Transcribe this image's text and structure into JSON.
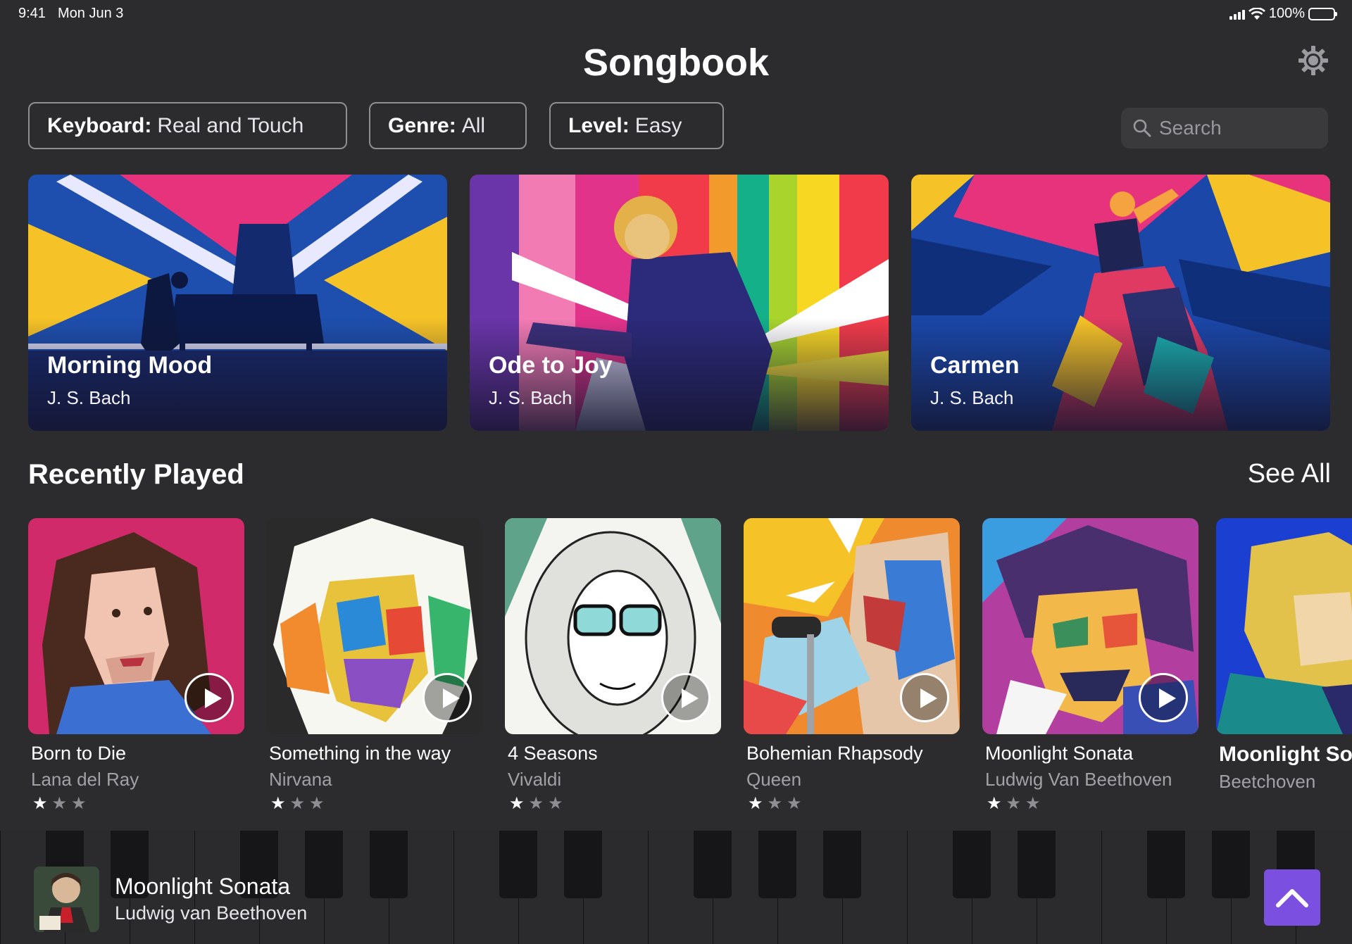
{
  "status": {
    "time": "9:41",
    "date": "Mon Jun 3",
    "battery": "100%",
    "battery_level": 1.0
  },
  "header": {
    "title": "Songbook",
    "settings_icon": "gear-icon"
  },
  "filters": [
    {
      "label": "Keyboard:",
      "value": "Real and Touch"
    },
    {
      "label": "Genre:",
      "value": "All"
    },
    {
      "label": "Level:",
      "value": "Easy"
    }
  ],
  "search": {
    "placeholder": "Search",
    "icon": "search-icon"
  },
  "featured": [
    {
      "title": "Morning Mood",
      "artist": "J. S. Bach"
    },
    {
      "title": "Ode to Joy",
      "artist": "J. S. Bach"
    },
    {
      "title": "Carmen",
      "artist": "J. S. Bach"
    }
  ],
  "recent": {
    "title": "Recently Played",
    "see_all": "See All",
    "items": [
      {
        "title": "Born to Die",
        "artist": "Lana del Ray",
        "rating": 1,
        "stars": "★",
        "stars_off": "★★"
      },
      {
        "title": "Something in the way",
        "artist": "Nirvana",
        "rating": 1,
        "stars": "★",
        "stars_off": "★★"
      },
      {
        "title": "4 Seasons",
        "artist": "Vivaldi",
        "rating": 1,
        "stars": "★",
        "stars_off": "★★"
      },
      {
        "title": "Bohemian Rhapsody",
        "artist": "Queen",
        "rating": 1,
        "stars": "★",
        "stars_off": "★★"
      },
      {
        "title": "Moonlight Sonata",
        "artist": "Ludwig Van Beethoven",
        "rating": 1,
        "stars": "★",
        "stars_off": "★★"
      },
      {
        "title": "Moonlight Sonata",
        "artist": "Beetchoven"
      }
    ]
  },
  "now_playing": {
    "title": "Moonlight Sonata",
    "artist": "Ludwig van Beethoven",
    "expand_icon": "chevron-up-icon"
  },
  "colors": {
    "background": "#2c2c2e",
    "accent": "#7b4fe0",
    "keyboard": "#2b2b2d"
  }
}
